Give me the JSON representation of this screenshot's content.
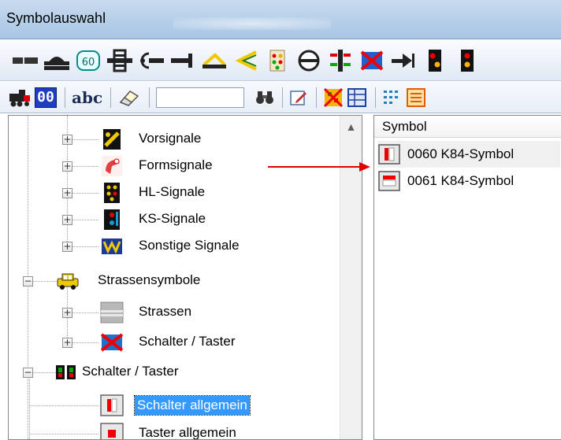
{
  "window": {
    "title": "Symbolauswahl"
  },
  "toolbar1": {
    "icons": [
      "track-straight-icon",
      "track-tunnel-icon",
      "counter-60-icon",
      "track-crossing-icon",
      "signal-left-icon",
      "track-end-icon",
      "track-yellow-diagonal-icon",
      "track-switch-icon",
      "signal-panel-icon",
      "circle-track-icon",
      "traffic-light-icon",
      "crossed-track-icon",
      "arrow-track-icon",
      "signal-red-yellow-icon",
      "signal-black-icon"
    ]
  },
  "toolbar2": {
    "abc_label": "abc",
    "num_label": "00",
    "search": {
      "value": "",
      "placeholder": ""
    }
  },
  "tree": {
    "items": [
      {
        "label": "Vorsignale",
        "expander": "+",
        "icon": "vorsignal-icon"
      },
      {
        "label": "Formsignale",
        "expander": "+",
        "icon": "formsignal-icon"
      },
      {
        "label": "HL-Signale",
        "expander": "+",
        "icon": "hl-signal-icon"
      },
      {
        "label": "KS-Signale",
        "expander": "+",
        "icon": "ks-signal-icon"
      },
      {
        "label": "Sonstige Signale",
        "expander": "+",
        "icon": "sonstige-signal-icon"
      },
      {
        "label": "Strassensymbole",
        "expander": "−",
        "icon": "car-icon"
      },
      {
        "label": "Strassen",
        "expander": "+",
        "icon": "road-icon"
      },
      {
        "label": "Schalter / Taster",
        "expander": "+",
        "icon": "crossed-switch-icon"
      },
      {
        "label": "Schalter / Taster",
        "expander": "−",
        "icon": "switch-pair-icon"
      },
      {
        "label": "Schalter allgemein",
        "expander": "",
        "icon": "switch-general-icon"
      },
      {
        "label": "Taster allgemein",
        "expander": "",
        "icon": "button-general-icon"
      }
    ]
  },
  "list": {
    "header": "Symbol",
    "items": [
      {
        "label": "0060 K84-Symbol",
        "icon": "k84-symbol-0060-icon"
      },
      {
        "label": "0061 K84-Symbol",
        "icon": "k84-symbol-0061-icon"
      }
    ]
  },
  "colors": {
    "selection": "#3399ff",
    "annotation_arrow": "#e00000"
  }
}
